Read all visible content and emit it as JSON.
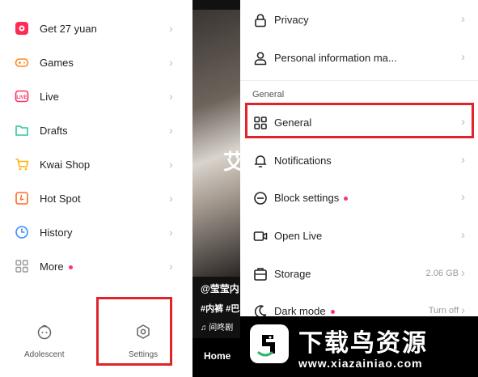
{
  "drawer": {
    "items": [
      {
        "label": "Get 27 yuan",
        "icon": "gift-icon",
        "dot": false
      },
      {
        "label": "Games",
        "icon": "gamepad-icon",
        "dot": false
      },
      {
        "label": "Live",
        "icon": "live-icon",
        "dot": false
      },
      {
        "label": "Drafts",
        "icon": "folder-icon",
        "dot": false
      },
      {
        "label": "Kwai Shop",
        "icon": "cart-icon",
        "dot": false
      },
      {
        "label": "Hot Spot",
        "icon": "hotspot-icon",
        "dot": false
      },
      {
        "label": "History",
        "icon": "clock-icon",
        "dot": false
      },
      {
        "label": "More",
        "icon": "grid-icon",
        "dot": true
      }
    ],
    "bottom": {
      "adolescent_label": "Adolescent",
      "settings_label": "Settings"
    }
  },
  "video": {
    "overlay_text": "艾",
    "user": "@莹莹内",
    "tags": "#内裤 #巴",
    "music": "♫ 间咚剧",
    "home_label": "Home"
  },
  "settings": {
    "items_top": [
      {
        "label": "Privacy",
        "icon": "lock-icon"
      },
      {
        "label": "Personal information ma...",
        "icon": "person-icon"
      }
    ],
    "section_title": "General",
    "items_general": [
      {
        "label": "General",
        "icon": "grid-icon",
        "value": "",
        "dot": false
      },
      {
        "label": "Notifications",
        "icon": "bell-icon",
        "value": "",
        "dot": false
      },
      {
        "label": "Block settings",
        "icon": "block-icon",
        "value": "",
        "dot": true
      },
      {
        "label": "Open Live",
        "icon": "camera-icon",
        "value": "",
        "dot": false
      },
      {
        "label": "Storage",
        "icon": "storage-icon",
        "value": "2.06 GB",
        "dot": false
      },
      {
        "label": "Dark mode",
        "icon": "moon-icon",
        "value": "Turn off",
        "dot": true
      }
    ]
  },
  "watermark": {
    "title": "下载鸟资源",
    "url": "www.xiazainiao.com"
  },
  "colors": {
    "highlight": "#e0242c",
    "dot": "#fe3666",
    "accent_orange": "#ff8a1f"
  }
}
